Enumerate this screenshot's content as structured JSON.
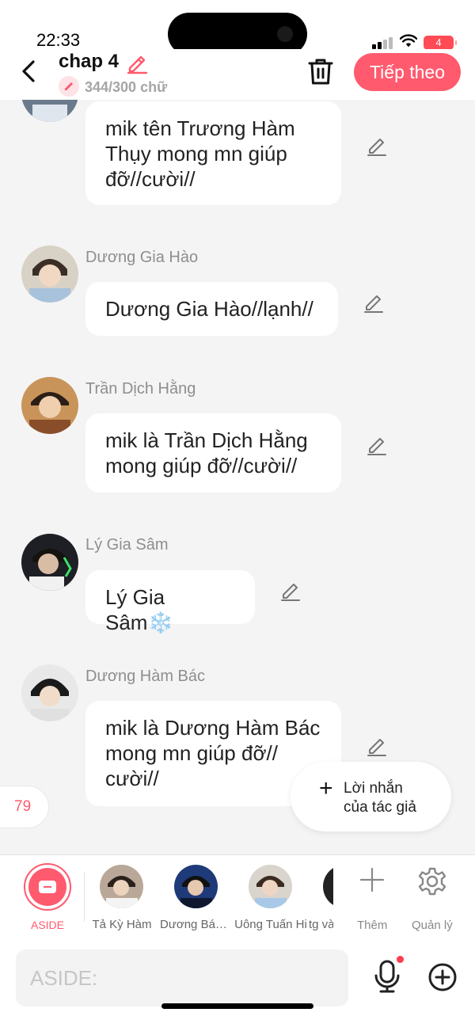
{
  "status": {
    "time": "22:33",
    "battery": "4"
  },
  "header": {
    "title": "chap 4",
    "word_count": "344/300 chữ",
    "next_label": "Tiếp theo"
  },
  "messages": [
    {
      "name": "",
      "text": "mik tên Trương Hàm Thụy mong mn giúp đỡ//cười//"
    },
    {
      "name": "Dương Gia Hào",
      "text": "Dương Gia Hào//lạnh//"
    },
    {
      "name": "Trần Dịch Hằng",
      "text": "mik là Trần Dịch Hằng mong giúp đỡ//cười//"
    },
    {
      "name": "Lý Gia Sâm",
      "text": "Lý Gia Sâm❄️"
    },
    {
      "name": "Dương Hàm Bác",
      "text": "mik là Dương Hàm Bác mong mn giúp đỡ// cười//"
    }
  ],
  "counter": "79",
  "author_note": {
    "plus": "+",
    "label_line1": "Lời nhắn",
    "label_line2": "của tác giả"
  },
  "char_bar": {
    "aside_label": "ASIDE",
    "characters": [
      {
        "name": "Tả Kỳ Hàm"
      },
      {
        "name": "Dương Bác Văn"
      },
      {
        "name": "Uông Tuấn Hi"
      },
      {
        "name": "tg vào"
      }
    ],
    "add_label": "Thêm",
    "manage_label": "Quản lý"
  },
  "input": {
    "placeholder": "ASIDE:"
  },
  "colors": {
    "accent": "#ff5a6e",
    "background": "#f4f4f4"
  }
}
